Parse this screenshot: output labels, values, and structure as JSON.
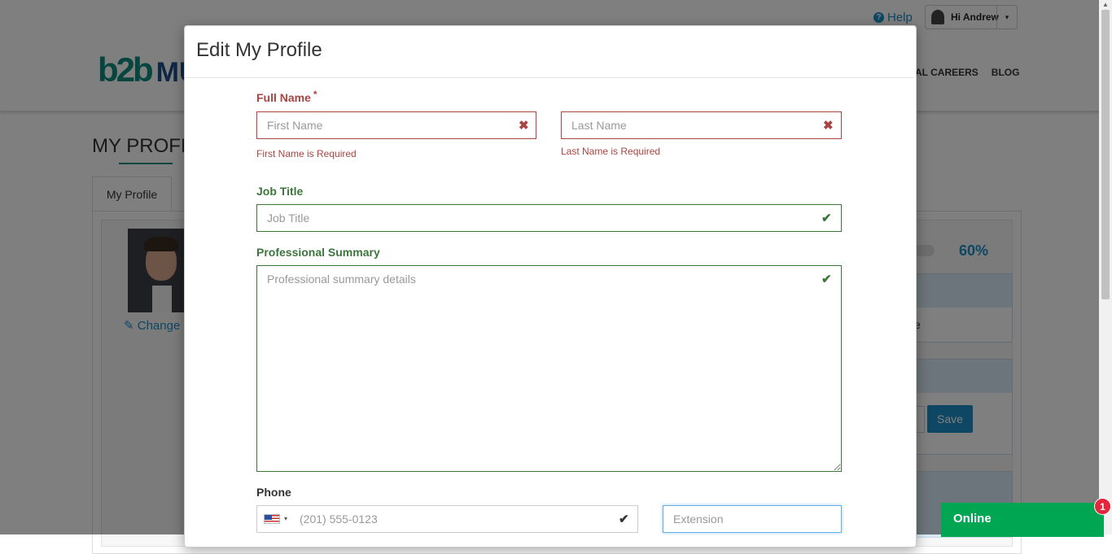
{
  "header": {
    "help_label": "Help",
    "help_icon": "question-circle-icon",
    "user_greeting": "Hi Andrew",
    "caret_glyph": "▾"
  },
  "brand": {
    "logo_mark": "b2b",
    "logo_text": "MU"
  },
  "nav": {
    "links": [
      "AL CAREERS",
      "BLOG"
    ]
  },
  "page": {
    "title": "MY PROFIL",
    "tab_label": "My Profile",
    "change_photo_label": "✎ Change",
    "progress_percent": 60,
    "progress_text": "60%",
    "sidebox_text": "e",
    "save_label": "Save"
  },
  "modal": {
    "title": "Edit My Profile",
    "full_name": {
      "label": "Full Name",
      "required_mark": "*",
      "first_placeholder": "First Name",
      "first_value": "",
      "first_error": "First Name is Required",
      "last_placeholder": "Last Name",
      "last_value": "",
      "last_error": "Last Name is Required",
      "error_icon": "✖"
    },
    "job_title": {
      "label": "Job Title",
      "placeholder": "Job Title",
      "value": "",
      "ok_icon": "✔"
    },
    "summary": {
      "label": "Professional Summary",
      "placeholder": "Professional summary details",
      "value": "",
      "ok_icon": "✔"
    },
    "phone": {
      "label": "Phone",
      "country_flag": "us-flag-icon",
      "placeholder": "(201) 555-0123",
      "value": "",
      "check_icon": "✔",
      "extension_placeholder": "Extension",
      "extension_value": ""
    }
  },
  "chat": {
    "label": "Online",
    "badge_count": "1"
  },
  "colors": {
    "error": "#a94442",
    "success": "#3c763d",
    "accent": "#1a8fc6",
    "chat": "#00a651",
    "badge": "#e3263b"
  }
}
